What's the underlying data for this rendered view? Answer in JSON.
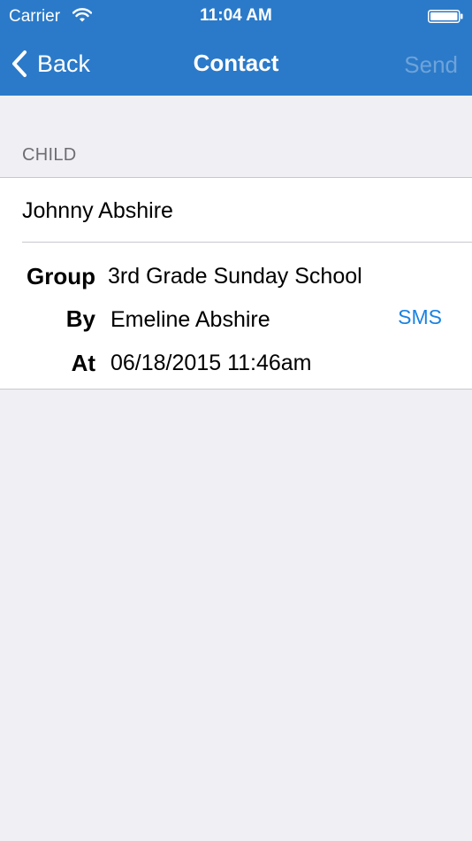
{
  "status_bar": {
    "carrier": "Carrier",
    "time": "11:04 AM"
  },
  "nav_bar": {
    "back_label": "Back",
    "title": "Contact",
    "send_label": "Send"
  },
  "section": {
    "header": "CHILD"
  },
  "child": {
    "name": "Johnny Abshire"
  },
  "details": {
    "group_label": "Group",
    "group_value": "3rd Grade Sunday School",
    "by_label": "By",
    "by_value": "Emeline Abshire",
    "sms_label": "SMS",
    "at_label": "At",
    "at_value": "06/18/2015 11:46am"
  },
  "colors": {
    "nav_blue": "#2b7ac9",
    "background": "#efeff4",
    "link_blue": "#1a82e2",
    "disabled_send": "#6ea3d9"
  },
  "icons": [
    "wifi-icon",
    "battery-icon",
    "back-chevron-icon"
  ]
}
